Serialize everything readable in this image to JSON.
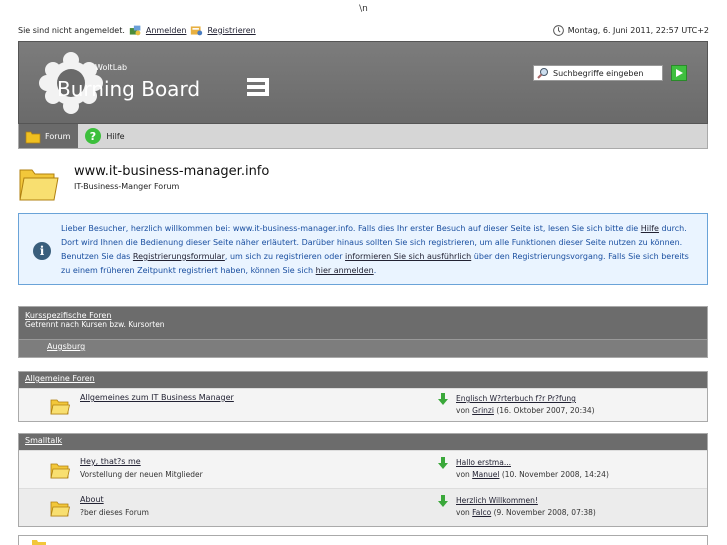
{
  "top_escape": "\\n",
  "userbar": {
    "status": "Sie sind nicht angemeldet.",
    "login_label": "Anmelden",
    "register_label": "Registrieren",
    "datetime": "Montag, 6. Juni 2011, 22:57 UTC+2"
  },
  "header": {
    "search_placeholder": "Suchbegriffe eingeben"
  },
  "tabs": [
    {
      "label": "Forum"
    },
    {
      "label": "Hilfe"
    }
  ],
  "board_header": {
    "title": "www.it-business-manager.info",
    "subtitle": "IT-Business-Manger Forum"
  },
  "info": {
    "t1": "Lieber Besucher, herzlich willkommen bei: www.it-business-manager.info. Falls dies Ihr erster Besuch auf dieser Seite ist, lesen Sie sich bitte die ",
    "help_link": "Hilfe",
    "t2": " durch. Dort wird Ihnen die Bedienung dieser Seite näher erläutert. Darüber hinaus sollten Sie sich registrieren, um alle Funktionen dieser Seite nutzen zu können. Benutzen Sie das ",
    "form_link": "Registrierungsformular",
    "t3": ", um sich zu registrieren oder ",
    "more_link": "informieren Sie sich ausführlich",
    "t4": " über den Registrierungsvorgang. Falls Sie sich bereits zu einem früheren Zeitpunkt registriert haben, können Sie sich ",
    "login_link": "hier anmelden",
    "t5": "."
  },
  "sections": {
    "kurs": {
      "title": "Kursspezifische Foren",
      "desc": "Getrennt nach Kursen bzw. Kursorten",
      "sub": "Augsburg"
    },
    "allg": {
      "title": "Allgemeine Foren",
      "boards": [
        {
          "name": "Allgemeines zum IT Business Manager",
          "desc": "",
          "lp_title": "Englisch W?rterbuch f?r Pr?fung",
          "lp_by": "von ",
          "lp_user": "Grinzi",
          "lp_date": " (16. Oktober 2007, 20:34)"
        }
      ]
    },
    "small": {
      "title": "Smalltalk",
      "boards": [
        {
          "name": "Hey, that?s me",
          "desc": "Vorstellung der neuen Mitglieder",
          "lp_title": "Hallo erstma...",
          "lp_by": "von ",
          "lp_user": "Manuel",
          "lp_date": " (10. November 2008, 14:24)"
        },
        {
          "name": "About",
          "desc": "?ber dieses Forum",
          "lp_title": "Herzlich Willkommen!",
          "lp_by": "von ",
          "lp_user": "Falco",
          "lp_date": " (9. November 2008, 07:38)"
        }
      ]
    }
  },
  "colors": {
    "header_bg": "#6a6a6a",
    "info_bg": "#eaf4ff",
    "info_border": "#6aa3d8",
    "info_text": "#1a4fa0",
    "section_head": "#6c6c6c"
  }
}
